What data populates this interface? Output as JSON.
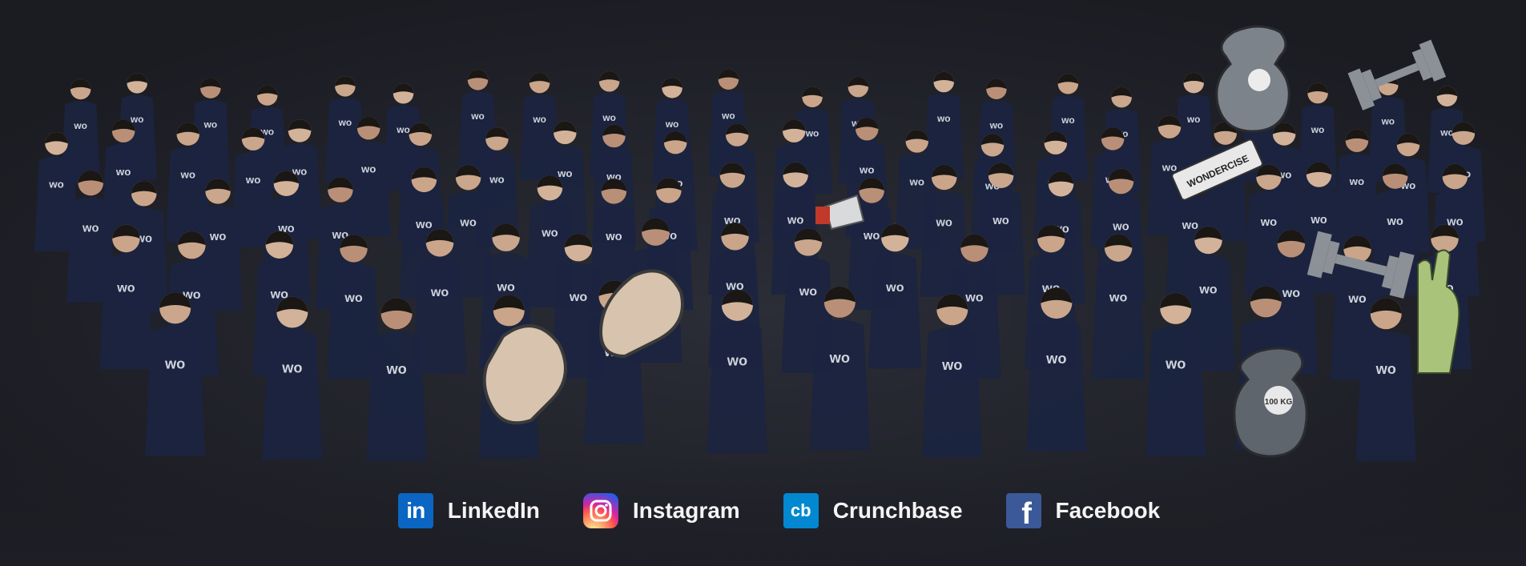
{
  "social": {
    "linkedin": {
      "label": "LinkedIn",
      "icon": "linkedin-icon",
      "glyph": "in",
      "color": "#0a66c2"
    },
    "instagram": {
      "label": "Instagram",
      "icon": "instagram-icon",
      "color": "#d6249f"
    },
    "crunchbase": {
      "label": "Crunchbase",
      "icon": "crunchbase-icon",
      "glyph": "cb",
      "color": "#0288d1"
    },
    "facebook": {
      "label": "Facebook",
      "icon": "facebook-icon",
      "glyph": "f",
      "color": "#3b5998"
    }
  },
  "photo": {
    "shirt_logo": "wo",
    "props": {
      "sign": "WONDERCISE",
      "kettlebell": "100 KG"
    }
  },
  "colors": {
    "background": "#1e1f26",
    "accent": "#b6f016",
    "shirt": "#1b2440"
  }
}
